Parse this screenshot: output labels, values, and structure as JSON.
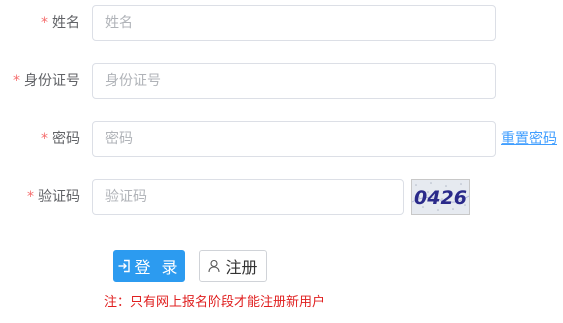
{
  "form": {
    "name": {
      "label": "姓名",
      "placeholder": "姓名",
      "value": ""
    },
    "id_number": {
      "label": "身份证号",
      "placeholder": "身份证号",
      "value": ""
    },
    "password": {
      "label": "密码",
      "placeholder": "密码",
      "value": "",
      "reset_link": "重置密码"
    },
    "captcha": {
      "label": "验证码",
      "placeholder": "验证码",
      "value": "",
      "image_text": "0426"
    },
    "required_mark": "*"
  },
  "actions": {
    "login_label": "登 录",
    "login_icon": "login-icon",
    "register_label": "注册",
    "register_icon": "user-icon"
  },
  "note": "注：只有网上报名阶段才能注册新用户",
  "colors": {
    "primary": "#2c9bf0",
    "link": "#409eff",
    "required": "#f56c6c",
    "note": "#e02020",
    "captcha_text": "#2a2a8a"
  }
}
